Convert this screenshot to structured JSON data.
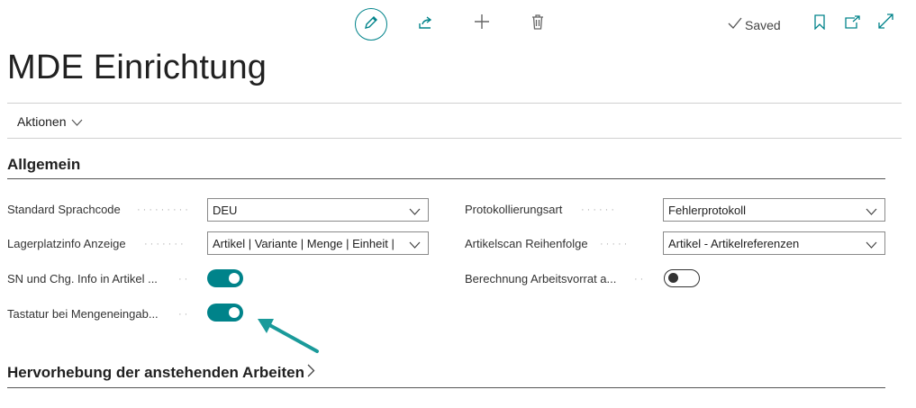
{
  "toolbar": {
    "edit_icon": "pencil-icon",
    "share_icon": "share-icon",
    "new_icon": "plus-icon",
    "delete_icon": "trash-icon",
    "saved_label": "Saved",
    "bookmark_icon": "bookmark-icon",
    "open_new_icon": "open-in-new-window-icon",
    "expand_icon": "expand-icon",
    "accent_color": "#00838a"
  },
  "page": {
    "title": "MDE Einrichtung"
  },
  "actions": {
    "label": "Aktionen"
  },
  "sections": {
    "general": {
      "title": "Allgemein"
    },
    "highlight": {
      "title": "Hervorhebung der anstehenden Arbeiten"
    }
  },
  "fields": {
    "language_code": {
      "label": "Standard Sprachcode",
      "value": "DEU"
    },
    "bin_info": {
      "label": "Lagerplatzinfo Anzeige",
      "value": "Artikel | Variante | Menge | Einheit |"
    },
    "sn_lot_info": {
      "label": "SN und Chg. Info in Artikel ...",
      "checked": true
    },
    "keyboard_qty": {
      "label": "Tastatur bei Mengeneingab...",
      "checked": true
    },
    "logging_type": {
      "label": "Protokollierungsart",
      "value": "Fehlerprotokoll"
    },
    "item_scan_order": {
      "label": "Artikelscan Reihenfolge",
      "value": "Artikel - Artikelreferenzen"
    },
    "work_calc": {
      "label": "Berechnung Arbeitsvorrat a...",
      "checked": false
    }
  }
}
